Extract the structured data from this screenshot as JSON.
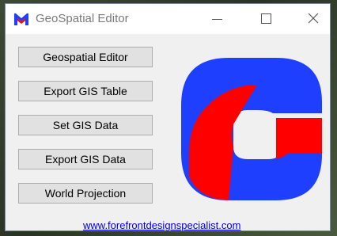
{
  "window": {
    "title": "GeoSpatial Editor"
  },
  "titlebar_icons": {
    "app": "app-logo-icon",
    "minimize": "minimize-icon",
    "maximize": "maximize-icon",
    "close": "close-icon"
  },
  "buttons": [
    {
      "label": "Geospatial Editor"
    },
    {
      "label": "Export GIS Table"
    },
    {
      "label": "Set GIS Data"
    },
    {
      "label": "Export GIS Data"
    },
    {
      "label": "World Projection"
    }
  ],
  "logo": {
    "colors": {
      "blue": "#1f3fff",
      "red": "#ff0000"
    }
  },
  "footer": {
    "link": "www.forefrontdesignspecialist.com"
  }
}
